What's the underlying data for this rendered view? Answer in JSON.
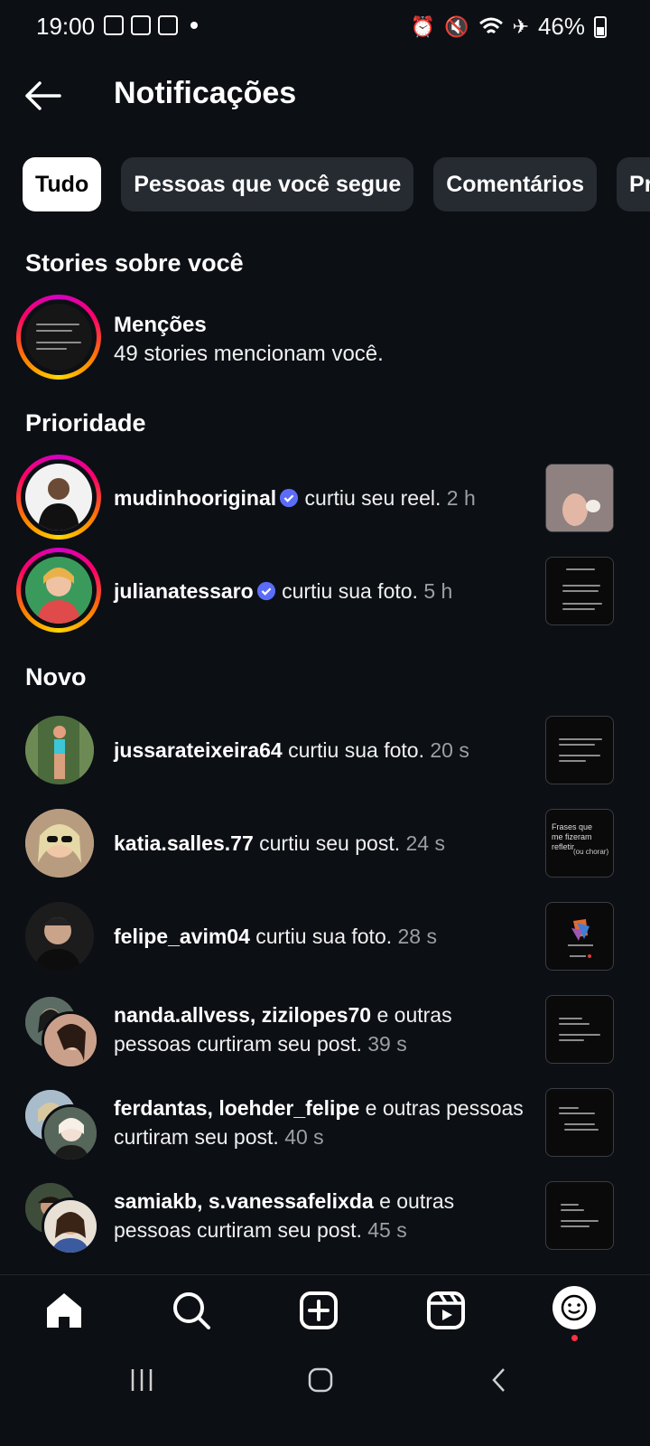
{
  "status_bar": {
    "time": "19:00",
    "battery": "46%"
  },
  "header": {
    "title": "Notificações"
  },
  "chips": [
    "Tudo",
    "Pessoas que você segue",
    "Comentários",
    "Pr"
  ],
  "sections": {
    "stories": "Stories sobre você",
    "priority": "Prioridade",
    "new": "Novo"
  },
  "mentions": {
    "title": "Menções",
    "subtitle": "49 stories mencionam você."
  },
  "priority": [
    {
      "user": "mudinhooriginal",
      "action": "curtiu seu reel.",
      "time": "2 h"
    },
    {
      "user": "julianatessaro",
      "action": "curtiu sua foto.",
      "time": "5 h"
    }
  ],
  "new": [
    {
      "user": "jussarateixeira64",
      "action": "curtiu sua foto.",
      "time": "20 s"
    },
    {
      "user": "katia.salles.77",
      "action": "curtiu seu post.",
      "time": "24 s"
    },
    {
      "user": "felipe_avim04",
      "action": "curtiu sua foto.",
      "time": "28 s"
    },
    {
      "users": "nanda.allvess, zizilopes70",
      "action": "e outras pessoas curtiram seu post.",
      "time": "39 s"
    },
    {
      "users": "ferdantas, loehder_felipe",
      "action": "e outras pessoas curtiram seu post.",
      "time": "40 s"
    },
    {
      "users": "samiakb, s.vanessafelixda",
      "action": "e outras pessoas curtiram seu post.",
      "time": "45 s"
    }
  ],
  "thumb_text": {
    "katia": "Frases que me fizeram refletir",
    "katia_sub": "(ou chorar)"
  },
  "colors": {
    "background": "#0c0f14",
    "chip": "#262a31",
    "verified": "#3897f0",
    "notify_dot": "#ff3040"
  },
  "icons": [
    "back-arrow-icon",
    "home-icon",
    "search-icon",
    "create-icon",
    "reels-icon",
    "profile-icon",
    "verified-icon"
  ]
}
